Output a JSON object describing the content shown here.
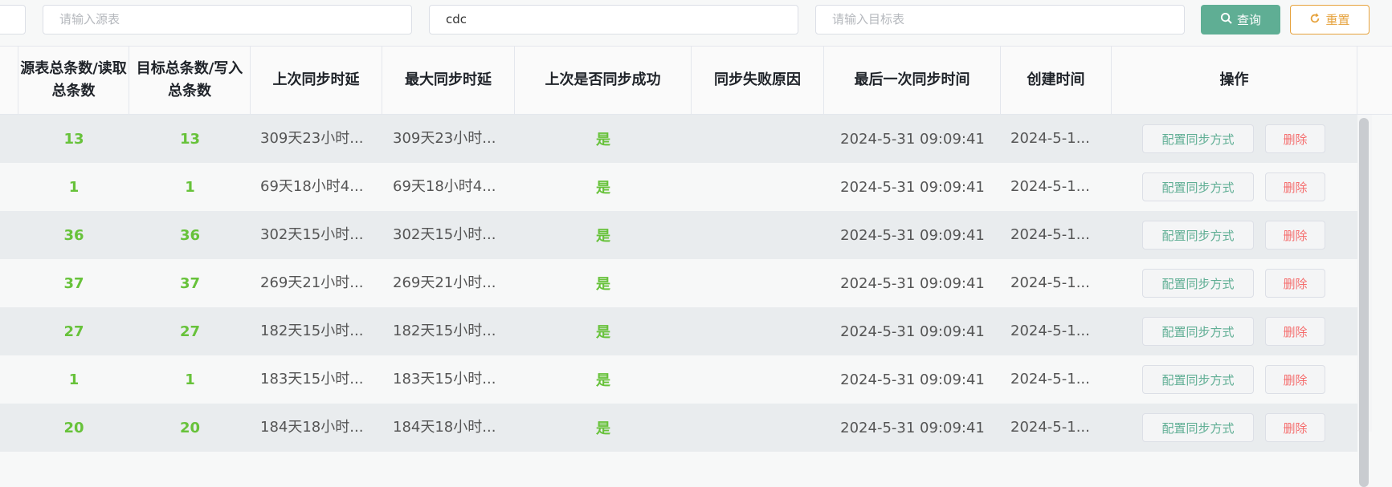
{
  "filters": {
    "source_placeholder": "请输入源表",
    "keyword_value": "cdc",
    "target_placeholder": "请输入目标表",
    "query_label": "查询",
    "reset_label": "重置"
  },
  "table": {
    "headers": [
      "源表总条数/读取总条数",
      "目标总条数/写入总条数",
      "上次同步时延",
      "最大同步时延",
      "上次是否同步成功",
      "同步失败原因",
      "最后一次同步时间",
      "创建时间",
      "操作"
    ],
    "rows": [
      {
        "src": "13",
        "dst": "13",
        "last_delay": "309天23小时...",
        "max_delay": "309天23小时...",
        "success": "是",
        "fail_reason": "",
        "last_sync": "2024-5-31 09:09:41",
        "created": "2024-5-1..."
      },
      {
        "src": "1",
        "dst": "1",
        "last_delay": "69天18小时4...",
        "max_delay": "69天18小时4...",
        "success": "是",
        "fail_reason": "",
        "last_sync": "2024-5-31 09:09:41",
        "created": "2024-5-1..."
      },
      {
        "src": "36",
        "dst": "36",
        "last_delay": "302天15小时...",
        "max_delay": "302天15小时...",
        "success": "是",
        "fail_reason": "",
        "last_sync": "2024-5-31 09:09:41",
        "created": "2024-5-1..."
      },
      {
        "src": "37",
        "dst": "37",
        "last_delay": "269天21小时...",
        "max_delay": "269天21小时...",
        "success": "是",
        "fail_reason": "",
        "last_sync": "2024-5-31 09:09:41",
        "created": "2024-5-1..."
      },
      {
        "src": "27",
        "dst": "27",
        "last_delay": "182天15小时...",
        "max_delay": "182天15小时...",
        "success": "是",
        "fail_reason": "",
        "last_sync": "2024-5-31 09:09:41",
        "created": "2024-5-1..."
      },
      {
        "src": "1",
        "dst": "1",
        "last_delay": "183天15小时...",
        "max_delay": "183天15小时...",
        "success": "是",
        "fail_reason": "",
        "last_sync": "2024-5-31 09:09:41",
        "created": "2024-5-1..."
      },
      {
        "src": "20",
        "dst": "20",
        "last_delay": "184天18小时...",
        "max_delay": "184天18小时...",
        "success": "是",
        "fail_reason": "",
        "last_sync": "2024-5-31 09:09:41",
        "created": "2024-5-1..."
      }
    ],
    "actions": {
      "configure_label": "配置同步方式",
      "delete_label": "删除"
    }
  },
  "colors": {
    "primary": "#5fae94",
    "warning": "#e6a23c",
    "success_text": "#67c23a",
    "danger": "#f56c6c"
  },
  "icons": {
    "query": "search-icon",
    "reset": "refresh-icon"
  }
}
